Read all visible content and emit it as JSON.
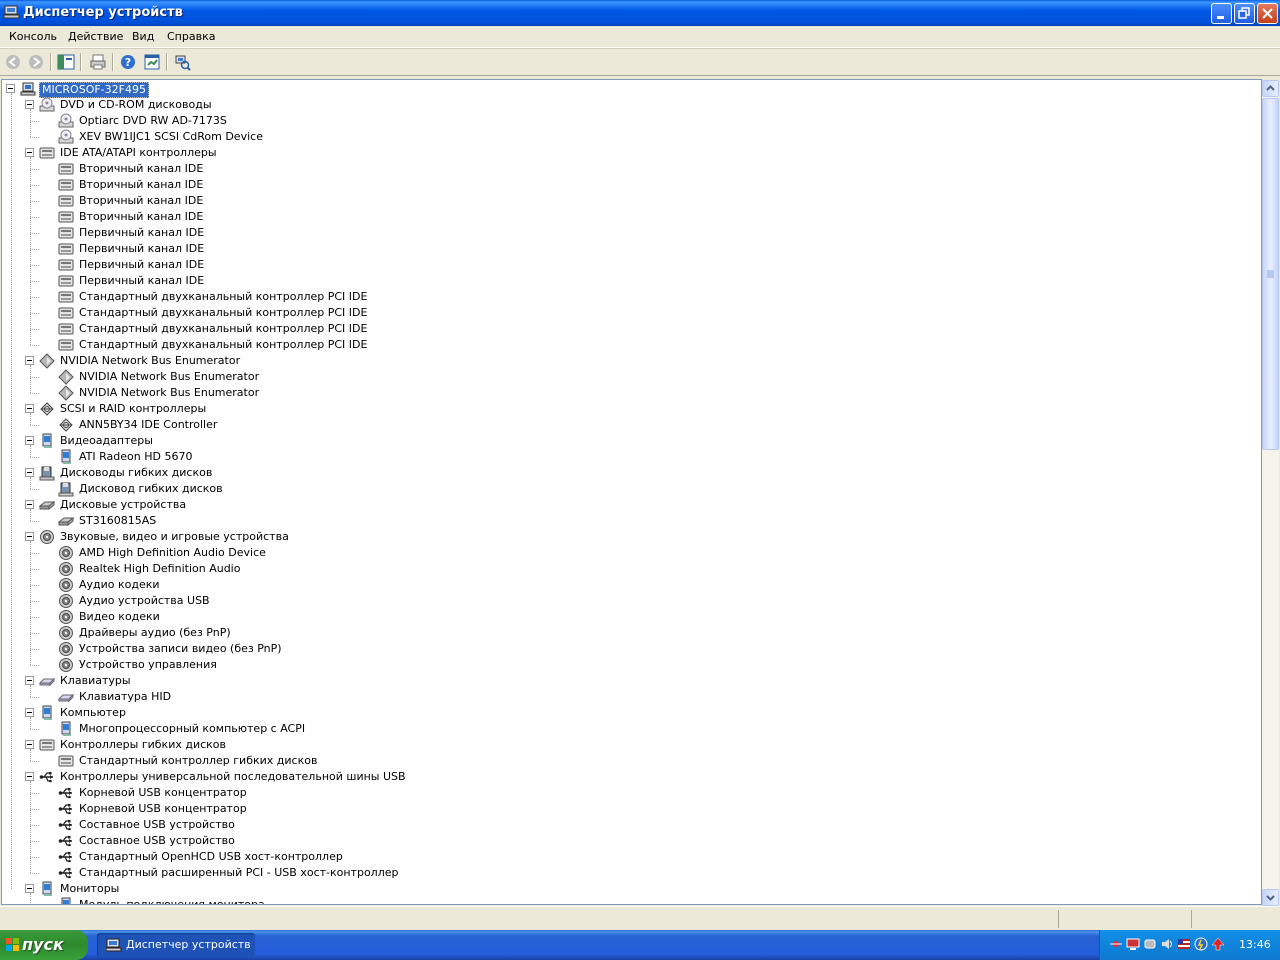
{
  "window": {
    "title": "Диспетчер устройств"
  },
  "menu": [
    "Консоль",
    "Действие",
    "Вид",
    "Справка"
  ],
  "toolbar": {
    "buttons": [
      "back-icon",
      "forward-icon",
      "show-hide-tree-icon",
      "print-icon",
      "help-icon",
      "properties-icon",
      "scan-hardware-icon"
    ]
  },
  "tree": {
    "root": "MICROSOF-32F495",
    "categories": [
      {
        "label": "DVD и CD-ROM дисководы",
        "icon": "cdrom-icon",
        "children": [
          "Optiarc DVD RW AD-7173S",
          "XEV BW1IJC1 SCSI CdRom Device"
        ]
      },
      {
        "label": "IDE ATA/ATAPI контроллеры",
        "icon": "ide-controller-icon",
        "children": [
          "Вторичный канал IDE",
          "Вторичный канал IDE",
          "Вторичный канал IDE",
          "Вторичный канал IDE",
          "Первичный канал IDE",
          "Первичный канал IDE",
          "Первичный канал IDE",
          "Первичный канал IDE",
          "Стандартный двухканальный контроллер PCI IDE",
          "Стандартный двухканальный контроллер PCI IDE",
          "Стандартный двухканальный контроллер PCI IDE",
          "Стандартный двухканальный контроллер PCI IDE"
        ]
      },
      {
        "label": "NVIDIA Network Bus Enumerator",
        "icon": "network-bus-icon",
        "children": [
          "NVIDIA Network Bus Enumerator",
          "NVIDIA Network Bus Enumerator"
        ]
      },
      {
        "label": "SCSI и RAID контроллеры",
        "icon": "scsi-icon",
        "children": [
          "ANN5BY34 IDE Controller"
        ]
      },
      {
        "label": "Видеоадаптеры",
        "icon": "display-adapter-icon",
        "children": [
          "ATI Radeon HD 5670"
        ]
      },
      {
        "label": "Дисководы гибких дисков",
        "icon": "floppy-drive-icon",
        "children": [
          "Дисковод гибких дисков"
        ]
      },
      {
        "label": "Дисковые устройства",
        "icon": "disk-drive-icon",
        "children": [
          "ST3160815AS"
        ]
      },
      {
        "label": "Звуковые, видео и игровые устройства",
        "icon": "sound-icon",
        "children": [
          "AMD High Definition Audio Device",
          "Realtek High Definition Audio",
          "Аудио кодеки",
          "Аудио устройства USB",
          "Видео кодеки",
          "Драйверы аудио (без PnP)",
          "Устройства записи видео (без PnP)",
          "Устройство управления"
        ]
      },
      {
        "label": "Клавиатуры",
        "icon": "keyboard-icon",
        "children": [
          "Клавиатура HID"
        ]
      },
      {
        "label": "Компьютер",
        "icon": "computer-icon",
        "children": [
          "Многопроцессорный компьютер с ACPI"
        ]
      },
      {
        "label": "Контроллеры гибких дисков",
        "icon": "floppy-controller-icon",
        "children": [
          "Стандартный контроллер гибких дисков"
        ]
      },
      {
        "label": "Контроллеры универсальной последовательной шины USB",
        "icon": "usb-icon",
        "children": [
          "Корневой USB концентратор",
          "Корневой USB концентратор",
          "Составное USB устройство",
          "Составное USB устройство",
          "Стандартный OpenHCD USB хост-контроллер",
          "Стандартный расширенный PCI - USB хост-контроллер"
        ]
      },
      {
        "label": "Мониторы",
        "icon": "monitor-icon",
        "children": [
          "Модуль подключения монитора"
        ]
      }
    ]
  },
  "taskbar": {
    "start_label": "пуск",
    "task_label": "Диспетчер устройств",
    "clock": "13:46"
  }
}
